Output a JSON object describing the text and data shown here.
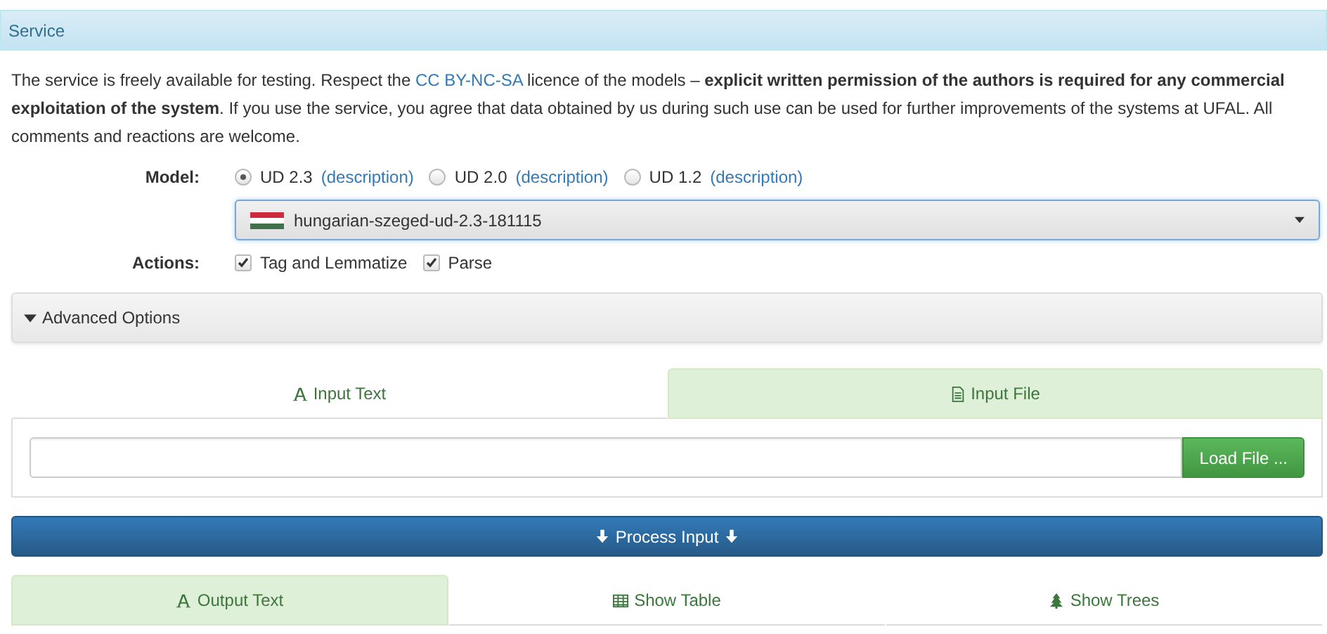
{
  "panel": {
    "title": "Service"
  },
  "notice": [
    {
      "kind": "text",
      "text": "The service is freely available for testing. Respect the "
    },
    {
      "kind": "link",
      "text": "CC BY-NC-SA"
    },
    {
      "kind": "text",
      "text": " licence of the models – **explicit written permission of the authors is required for any commercial exploitation of the system**. If you use the service, you agree that data obtained by us during such use can be used for further improvements of the systems at UFAL. All comments and reactions are welcome."
    }
  ],
  "model": {
    "label": "Model:",
    "options": [
      {
        "label": "UD 2.3",
        "link": "(description)",
        "selected": true
      },
      {
        "label": "UD 2.0",
        "link": "(description)",
        "selected": false
      },
      {
        "label": "UD 1.2",
        "link": "(description)",
        "selected": false
      }
    ],
    "dropdown": {
      "value": "hungarian-szeged-ud-2.3-181115"
    }
  },
  "actions": {
    "label": "Actions:",
    "items": [
      {
        "label": "Tag and Lemmatize",
        "checked": true
      },
      {
        "label": "Parse",
        "checked": true
      }
    ]
  },
  "advanced": {
    "label": "Advanced Options",
    "expanded": false
  },
  "input_tabs": [
    {
      "label": "Input Text",
      "kind": "text",
      "selected": false
    },
    {
      "label": "Input File",
      "kind": "file",
      "selected": true
    }
  ],
  "file_button": "Load File ...",
  "process_button": "Process Input",
  "output_tabs": [
    {
      "label": "Output Text",
      "kind": "text",
      "selected": true
    },
    {
      "label": "Show Table",
      "kind": "table",
      "selected": false
    },
    {
      "label": "Show Trees",
      "kind": "trees",
      "selected": false
    }
  ]
}
